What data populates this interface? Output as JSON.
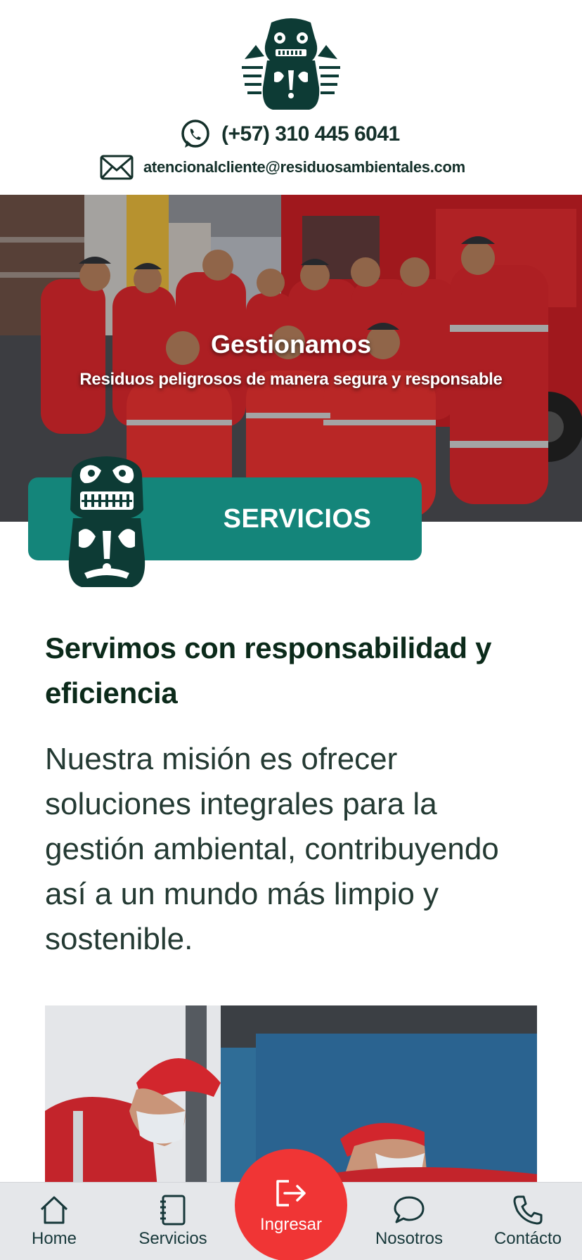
{
  "header": {
    "logo_icon": "totem-logo",
    "phone": "(+57) 310 445 6041",
    "email": "atencionalcliente@residuosambientales.com"
  },
  "hero": {
    "title": "Gestionamos",
    "subtitle": "Residuos peligrosos de manera segura y responsable"
  },
  "services": {
    "label": "SERVICIOS"
  },
  "content": {
    "heading": "Servimos con responsabilidad y eficiencia",
    "mission": "Nuestra misión es ofrecer soluciones integrales para la gestión ambiental, contribuyendo así a un mundo más limpio y sostenible."
  },
  "nav": {
    "home": "Home",
    "servicios": "Servicios",
    "ingresar": "Ingresar",
    "nosotros": "Nosotros",
    "contacto": "Contácto"
  },
  "colors": {
    "brand_teal": "#14857a",
    "brand_dark": "#0d3b35",
    "accent_red": "#f03535",
    "nav_bg": "#e5e7ea"
  }
}
